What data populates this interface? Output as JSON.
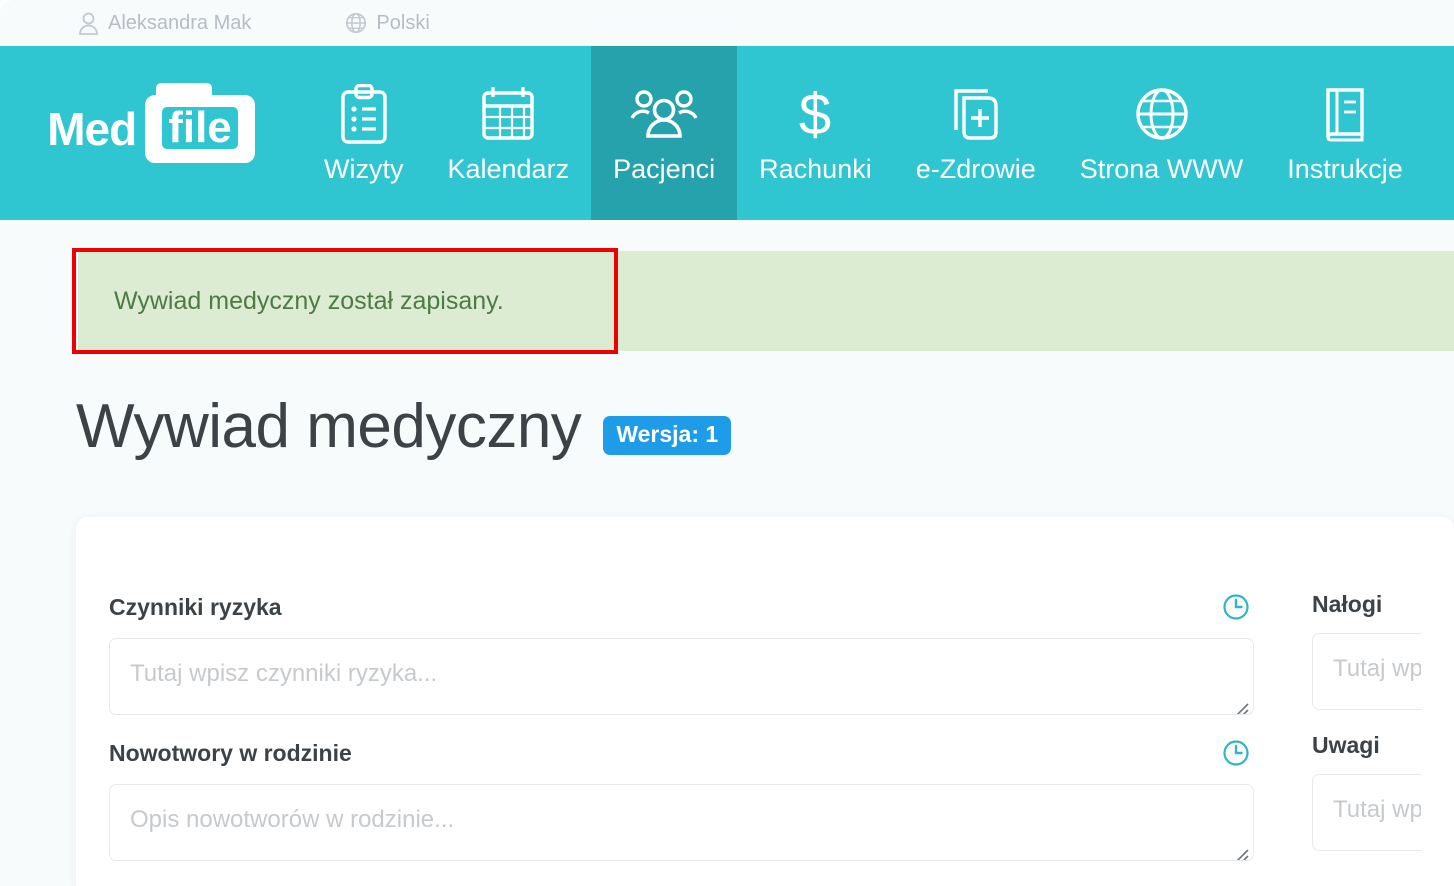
{
  "topbar": {
    "user": {
      "icon": "user-icon",
      "label": "Aleksandra Mak"
    },
    "language": {
      "icon": "globe-icon",
      "label": "Polski"
    }
  },
  "brand": {
    "word1": "Med",
    "word2": "file"
  },
  "nav": {
    "items": [
      {
        "icon": "clipboard-icon",
        "label": "Wizyty",
        "active": false
      },
      {
        "icon": "calendar-icon",
        "label": "Kalendarz",
        "active": false
      },
      {
        "icon": "patients-icon",
        "label": "Pacjenci",
        "active": true
      },
      {
        "icon": "dollar-icon",
        "label": "Rachunki",
        "active": false
      },
      {
        "icon": "medical-file-icon",
        "label": "e-Zdrowie",
        "active": false
      },
      {
        "icon": "globe-icon",
        "label": "Strona WWW",
        "active": false
      },
      {
        "icon": "book-icon",
        "label": "Instrukcje",
        "active": false
      }
    ],
    "active_bg": "#26a2ad",
    "bg": "#2fc6d2"
  },
  "alert": {
    "message": "Wywiad medyczny został zapisany.",
    "bg": "#dcecd2",
    "text_color": "#4e7a46",
    "annotation_color": "#ee0000"
  },
  "page": {
    "title": "Wywiad medyczny",
    "badge": "Wersja: 1",
    "badge_color": "#1e9ce8"
  },
  "form": {
    "left": [
      {
        "label": "Czynniki ryzyka",
        "placeholder": "Tutaj wpisz czynniki ryzyka...",
        "value": "",
        "history_icon": "clock-history-icon"
      },
      {
        "label": "Nowotwory w rodzinie",
        "placeholder": "Opis nowotworów w rodzinie...",
        "value": "",
        "history_icon": "clock-history-icon"
      }
    ],
    "right": [
      {
        "label": "Nałogi",
        "placeholder": "Tutaj wpisz...",
        "value": ""
      },
      {
        "label": "Uwagi",
        "placeholder": "Tutaj wpisz...",
        "value": ""
      }
    ]
  }
}
